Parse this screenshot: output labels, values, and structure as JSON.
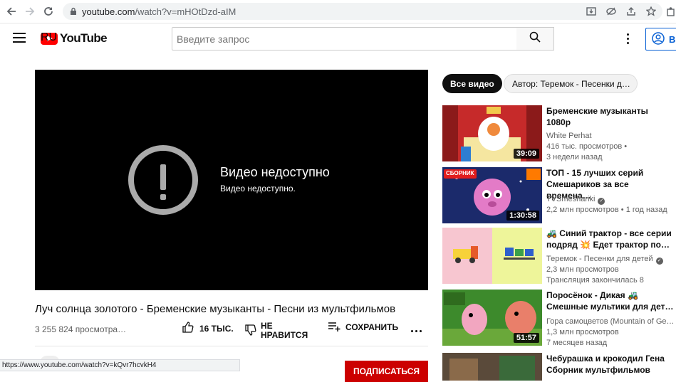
{
  "browser": {
    "url_host": "youtube.com",
    "url_path": "/watch?v=mHOtDzd-aIM"
  },
  "header": {
    "logo_text": "YouTube",
    "region": "RU",
    "search_placeholder": "Введите запрос",
    "signin_label": "В"
  },
  "player": {
    "error_title": "Видео недоступно",
    "error_subtitle": "Видео недоступно."
  },
  "video": {
    "title": "Луч солнца золотого - Бременские музыканты - Песни из мультфильмов",
    "views": "3 255 824 просмотра…",
    "like_label": "16 ТЫС.",
    "dislike_label": "НЕ НРАВИТСЯ",
    "save_label": "СОХРАНИТЬ",
    "subscribe_label": "ПОДПИСАТЬСЯ"
  },
  "status_bar": {
    "url": "https://www.youtube.com/watch?v=kQvr7hcvkH4"
  },
  "chips": [
    {
      "label": "Все видео",
      "active": true
    },
    {
      "label": "Автор: Теремок - Песенки д…",
      "active": false
    }
  ],
  "recommendations": [
    {
      "title": "Бременские музыканты 1080p",
      "channel": "White Perhat",
      "views": "416 тыс. просмотров",
      "age": "3 недели назад",
      "duration": "39:09"
    },
    {
      "title": "ТОП - 15 лучших серий Смешариков за все времена…",
      "channel": "TVSmeshariki",
      "views": "2,2 млн просмотров",
      "age": "1 год назад",
      "duration": "1:30:58",
      "thumb_badge": "СБОРНИК"
    },
    {
      "title": "🚜 Синий трактор - все серии подряд 💥 Едет трактор по…",
      "channel": "Теремок - Песенки для детей",
      "views": "2,3 млн просмотров",
      "age": "Трансляция закончилась 8"
    },
    {
      "title": "Поросёнок - Дикая 🚜 Смешные мультики для дет…",
      "channel": "Гора самоцветов (Mountain of Ge…",
      "views": "1,3 млн просмотров",
      "age": "7 месяцев назад",
      "duration": "51:57"
    },
    {
      "title": "Чебурашка и крокодил Гена Сборник мультфильмов"
    }
  ]
}
